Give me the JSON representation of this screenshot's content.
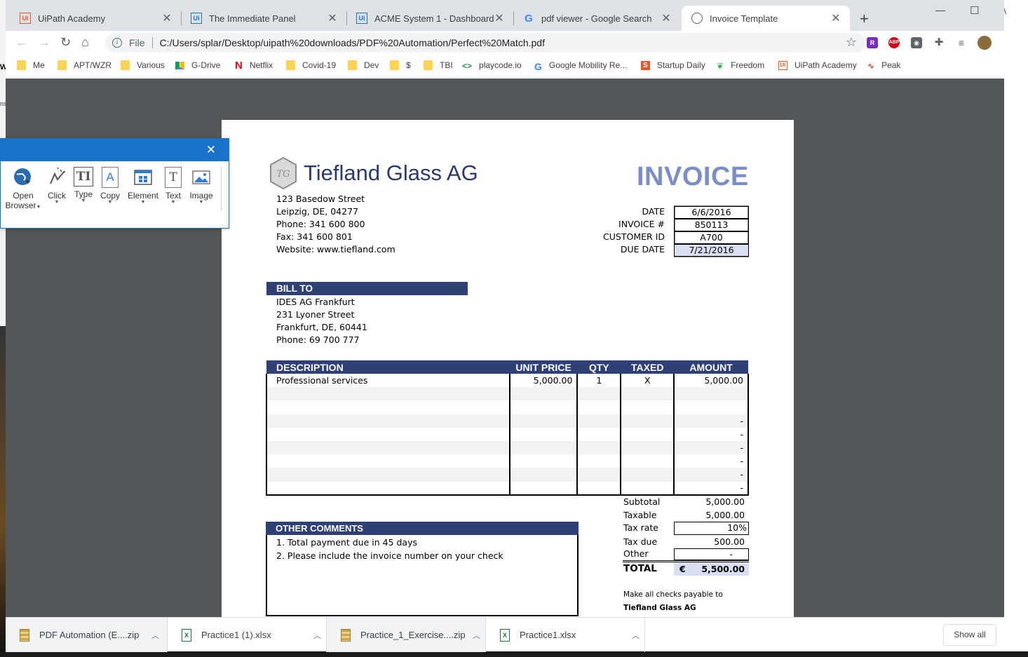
{
  "browser": {
    "tabs": [
      {
        "title": "UiPath Academy",
        "icon": "uipath-orange-icon"
      },
      {
        "title": "The Immediate Panel",
        "icon": "uipath-blue-icon"
      },
      {
        "title": "ACME System 1 - Dashboard",
        "icon": "uipath-blue-icon"
      },
      {
        "title": "pdf viewer - Google Search",
        "icon": "google-icon"
      },
      {
        "title": "Invoice Template",
        "icon": "globe-icon",
        "active": true
      }
    ],
    "address": {
      "scheme": "File",
      "url": "C:/Users/splar/Desktop/uipath%20downloads/PDF%20Automation/Perfect%20Match.pdf"
    },
    "bookmarks": [
      {
        "label": "Me",
        "icon": "folder-icon"
      },
      {
        "label": "APT/WZR",
        "icon": "folder-icon"
      },
      {
        "label": "Various",
        "icon": "folder-icon"
      },
      {
        "label": "G-Drive",
        "icon": "google-drive-icon"
      },
      {
        "label": "Netflix",
        "icon": "netflix-icon"
      },
      {
        "label": "Covid-19",
        "icon": "folder-icon"
      },
      {
        "label": "Dev",
        "icon": "folder-icon"
      },
      {
        "label": "$",
        "icon": "folder-icon"
      },
      {
        "label": "TBI",
        "icon": "folder-icon"
      },
      {
        "label": "playcode.io",
        "icon": "playcode-icon"
      },
      {
        "label": "Google Mobility Re...",
        "icon": "google-icon"
      },
      {
        "label": "Startup Daily",
        "icon": "startup-daily-icon"
      },
      {
        "label": "Freedom",
        "icon": "freedom-icon"
      },
      {
        "label": "UiPath Academy",
        "icon": "uipath-orange-icon"
      },
      {
        "label": "Peak",
        "icon": "peak-icon"
      }
    ],
    "extensions": [
      "rakuten-icon",
      "adblock-icon",
      "privacy-icon",
      "extensions-puzzle-icon",
      "reading-list-icon",
      "profile-avatar"
    ]
  },
  "recorder": {
    "tools": [
      {
        "label": "Open Browser",
        "line1": "Open",
        "line2": "Browser",
        "icon": "globe-cursor-icon"
      },
      {
        "label": "Click",
        "icon": "click-cursor-icon"
      },
      {
        "label": "Type",
        "icon": "type-text-icon"
      },
      {
        "label": "Copy",
        "icon": "copy-text-icon"
      },
      {
        "label": "Element",
        "icon": "element-grid-icon"
      },
      {
        "label": "Text",
        "icon": "text-scrape-icon"
      },
      {
        "label": "Image",
        "icon": "image-icon"
      }
    ]
  },
  "invoice": {
    "company": "Tiefland Glass AG",
    "title": "INVOICE",
    "address_lines": [
      "123 Basedow Street",
      "Leipzig, DE, 04277",
      "Phone: 341 600 800",
      "Fax: 341 600 801",
      "Website: www.tiefland.com"
    ],
    "meta": [
      {
        "label": "DATE",
        "value": "6/6/2016"
      },
      {
        "label": "INVOICE #",
        "value": "850113"
      },
      {
        "label": "CUSTOMER ID",
        "value": "A700"
      },
      {
        "label": "DUE DATE",
        "value": "7/21/2016"
      }
    ],
    "bill_to": {
      "header": "BILL TO",
      "lines": [
        "IDES AG Frankfurt",
        "231 Lyoner Street",
        "Frankfurt, DE, 60441",
        "Phone: 69 700 777"
      ]
    },
    "table": {
      "headers": [
        "DESCRIPTION",
        "UNIT PRICE",
        "QTY",
        "TAXED",
        "AMOUNT"
      ],
      "rows": [
        [
          "Professional services",
          "5,000.00",
          "1",
          "X",
          "5,000.00"
        ],
        [
          "",
          "",
          "",
          "",
          ""
        ],
        [
          "",
          "",
          "",
          "",
          ""
        ],
        [
          "",
          "",
          "",
          "",
          "-"
        ],
        [
          "",
          "",
          "",
          "",
          "-"
        ],
        [
          "",
          "",
          "",
          "",
          "-"
        ],
        [
          "",
          "",
          "",
          "",
          "-"
        ],
        [
          "",
          "",
          "",
          "",
          "-"
        ],
        [
          "",
          "",
          "",
          "",
          "-"
        ]
      ]
    },
    "totals": {
      "subtotal_label": "Subtotal",
      "subtotal": "5,000.00",
      "taxable_label": "Taxable",
      "taxable": "5,000.00",
      "tax_rate_label": "Tax rate",
      "tax_rate": "10%",
      "tax_due_label": "Tax due",
      "tax_due": "500.00",
      "other_label": "Other",
      "other": "-",
      "total_label": "TOTAL",
      "currency": "€",
      "total": "5,500.00"
    },
    "comments": {
      "header": "OTHER COMMENTS",
      "lines": [
        "1. Total payment due in 45 days",
        "2. Please include the invoice number on your check"
      ]
    },
    "payable": {
      "line1": "Make all checks payable to",
      "line2": "Tiefland Glass AG"
    }
  },
  "downloads": {
    "items": [
      {
        "name": "PDF Automation (E....zip",
        "type": "zip"
      },
      {
        "name": "Practice1 (1).xlsx",
        "type": "xlsx"
      },
      {
        "name": "Practice_1_Exercise....zip",
        "type": "zip"
      },
      {
        "name": "Practice1.xlsx",
        "type": "xlsx"
      }
    ],
    "show_all": "Show all"
  },
  "colors": {
    "accent": "#2f4076",
    "invoice_title": "#7c8ec7",
    "highlight": "#d9dff0",
    "recorder": "#1a73c8"
  }
}
